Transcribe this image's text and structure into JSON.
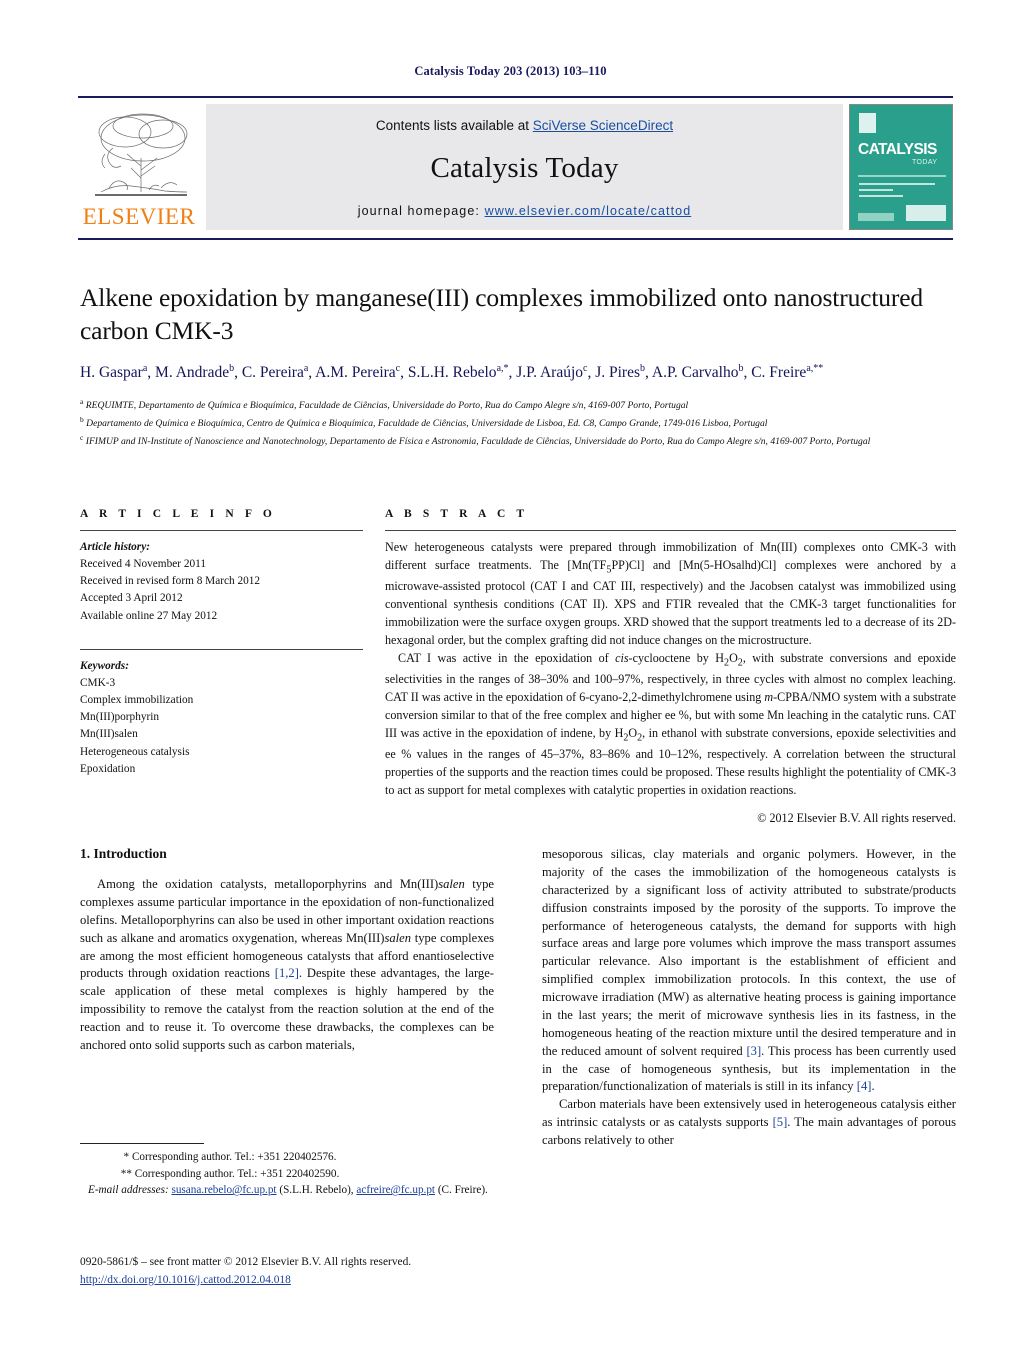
{
  "running_head": "Catalysis Today 203 (2013) 103–110",
  "masthead": {
    "contents_prefix": "Contents lists available at ",
    "sciencedirect": "SciVerse ScienceDirect",
    "journal_name": "Catalysis Today",
    "homepage_label": "journal homepage: ",
    "homepage_url": "www.elsevier.com/locate/cattod",
    "publisher_logo_text": "ELSEVIER",
    "cover_title": "CATALYSIS",
    "cover_subtitle": "TODAY",
    "accent_color": "#1a4fa0",
    "rule_color": "#1a1a5e",
    "cover_color": "#2aa08c",
    "elsevier_orange": "#f07f13"
  },
  "article": {
    "title": "Alkene epoxidation by manganese(III) complexes immobilized onto nanostructured carbon CMK-3",
    "authors_html": "H. Gaspar<sup>a</sup>, M. Andrade<sup>b</sup>, C. Pereira<sup>a</sup>, A.M. Pereira<sup>c</sup>, S.L.H. Rebelo<sup>a,*</sup>, J.P. Araújo<sup>c</sup>, J. Pires<sup>b</sup>, A.P. Carvalho<sup>b</sup>, C. Freire<sup>a,**</sup>",
    "affiliations": [
      "REQUIMTE, Departamento de Química e Bioquímica, Faculdade de Ciências, Universidade do Porto, Rua do Campo Alegre s/n, 4169-007 Porto, Portugal",
      "Departamento de Química e Bioquímica, Centro de Química e Bioquímica, Faculdade de Ciências, Universidade de Lisboa, Ed. C8, Campo Grande, 1749-016 Lisboa, Portugal",
      "IFIMUP and IN-Institute of Nanoscience and Nanotechnology, Departamento de Física e Astronomia, Faculdade de Ciências, Universidade do Porto, Rua do Campo Alegre s/n, 4169-007 Porto, Portugal"
    ],
    "affiliation_marks": [
      "a",
      "b",
      "c"
    ]
  },
  "article_info": {
    "heading": "A R T I C L E    I N F O",
    "history_label": "Article history:",
    "history": [
      "Received 4 November 2011",
      "Received in revised form 8 March 2012",
      "Accepted 3 April 2012",
      "Available online 27 May 2012"
    ],
    "keywords_label": "Keywords:",
    "keywords": [
      "CMK-3",
      "Complex immobilization",
      "Mn(III)porphyrin",
      "Mn(III)salen",
      "Heterogeneous catalysis",
      "Epoxidation"
    ]
  },
  "abstract": {
    "heading": "A B S T R A C T",
    "paragraph_1_html": "New heterogeneous catalysts were prepared through immobilization of Mn(III) complexes onto CMK-3 with different surface treatments. The [Mn(TF<sub>5</sub>PP)Cl] and [Mn(5-HOsalhd)Cl] complexes were anchored by a microwave-assisted protocol (CAT I and CAT III, respectively) and the Jacobsen catalyst was immobilized using conventional synthesis conditions (CAT II). XPS and FTIR revealed that the CMK-3 target functionalities for immobilization were the surface oxygen groups. XRD showed that the support treatments led to a decrease of its 2D-hexagonal order, but the complex grafting did not induce changes on the microstructure.",
    "paragraph_2_html": "CAT I was active in the epoxidation of <i>cis</i>-cyclooctene by H<sub>2</sub>O<sub>2</sub>, with substrate conversions and epoxide selectivities in the ranges of 38–30% and 100–97%, respectively, in three cycles with almost no complex leaching. CAT II was active in the epoxidation of 6-cyano-2,2-dimethylchromene using <i>m</i>-CPBA/NMO system with a substrate conversion similar to that of the free complex and higher ee %, but with some Mn leaching in the catalytic runs. CAT III was active in the epoxidation of indene, by H<sub>2</sub>O<sub>2</sub>, in ethanol with substrate conversions, epoxide selectivities and ee % values in the ranges of 45–37%, 83–86% and 10–12%, respectively. A correlation between the structural properties of the supports and the reaction times could be proposed. These results highlight the potentiality of CMK-3 to act as support for metal complexes with catalytic properties in oxidation reactions.",
    "copyright": "© 2012 Elsevier B.V. All rights reserved."
  },
  "introduction": {
    "heading": "1.  Introduction",
    "left_column_html": "Among the oxidation catalysts, metalloporphyrins and Mn(III)<i>salen</i> type complexes assume particular importance in the epoxidation of non-functionalized olefins. Metalloporphyrins can also be used in other important oxidation reactions such as alkane and aromatics oxygenation, whereas Mn(III)<i>salen</i> type complexes are among the most efficient homogeneous catalysts that afford enantioselective products through oxidation reactions <span class=\"ref\">[1,2]</span>. Despite these advantages, the large-scale application of these metal complexes is highly hampered by the impossibility to remove the catalyst from the reaction solution at the end of the reaction and to reuse it. To overcome these drawbacks, the complexes can be anchored onto solid supports such as carbon materials,",
    "right_column_p1_html": "mesoporous silicas, clay materials and organic polymers. However, in the majority of the cases the immobilization of the homogeneous catalysts is characterized by a significant loss of activity attributed to substrate/products diffusion constraints imposed by the porosity of the supports. To improve the performance of heterogeneous catalysts, the demand for supports with high surface areas and large pore volumes which improve the mass transport assumes particular relevance. Also important is the establishment of efficient and simplified complex immobilization protocols. In this context, the use of microwave irradiation (MW) as alternative heating process is gaining importance in the last years; the merit of microwave synthesis lies in its fastness, in the homogeneous heating of the reaction mixture until the desired temperature and in the reduced amount of solvent required <span class=\"ref\">[3]</span>. This process has been currently used in the case of homogeneous synthesis, but its implementation in the preparation/functionalization of materials is still in its infancy <span class=\"ref\">[4]</span>.",
    "right_column_p2_html": "Carbon materials have been extensively used in heterogeneous catalysis either as intrinsic catalysts or as catalysts supports <span class=\"ref\">[5]</span>. The main advantages of porous carbons relatively to other"
  },
  "footnotes": {
    "line1": "* Corresponding author. Tel.: +351 220402576.",
    "line2": "** Corresponding author. Tel.: +351 220402590.",
    "emails_label": "E-mail addresses:",
    "email1": "susana.rebelo@fc.up.pt",
    "email1_owner": "(S.L.H. Rebelo),",
    "email2": "acfreire@fc.up.pt",
    "email2_owner": "(C. Freire)."
  },
  "imprint": {
    "line1": "0920-5861/$ – see front matter © 2012 Elsevier B.V. All rights reserved.",
    "doi": "http://dx.doi.org/10.1016/j.cattod.2012.04.018"
  }
}
